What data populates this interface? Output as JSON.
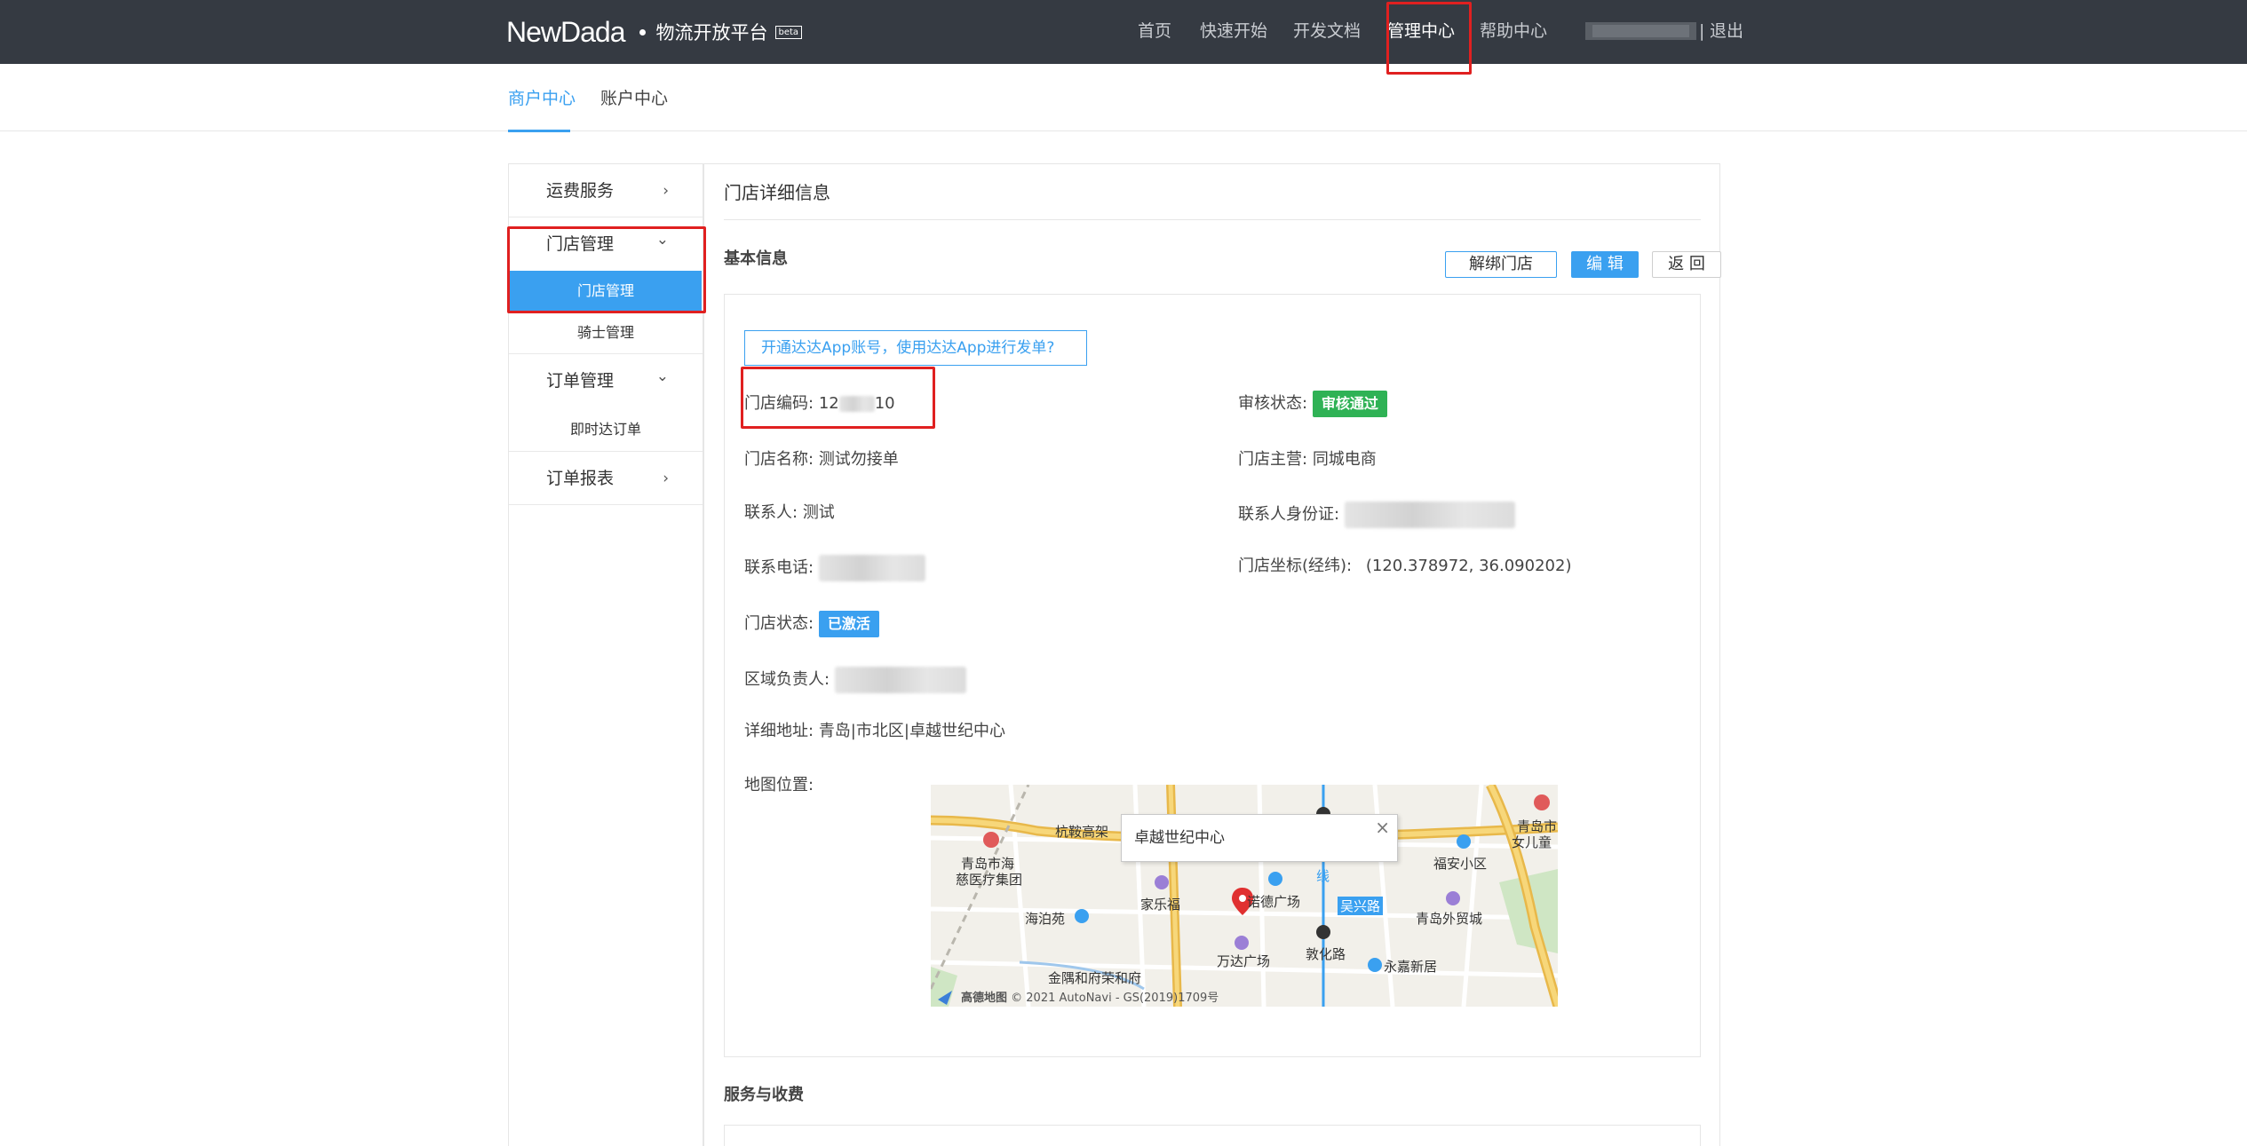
{
  "header": {
    "brand": "NewDada",
    "platform": "物流开放平台",
    "beta": "beta",
    "nav": [
      "首页",
      "快速开始",
      "开发文档",
      "管理中心",
      "帮助中心"
    ],
    "separator": "|",
    "logout": "退出"
  },
  "subnav": {
    "tabs": [
      "商户中心",
      "账户中心"
    ]
  },
  "sidebar": {
    "freight": "运费服务",
    "store_mgmt": "门店管理",
    "store_mgmt_sub": "门店管理",
    "rider_mgmt": "骑士管理",
    "order_mgmt": "订单管理",
    "instant_order": "即时达订单",
    "order_report": "订单报表",
    "chevron_right": "›",
    "chevron_down": "⌄"
  },
  "main": {
    "title": "门店详细信息",
    "basic_info": "基本信息",
    "buttons": {
      "unbind": "解绑门店",
      "edit": "编 辑",
      "back": "返 回"
    },
    "promo": "开通达达App账号，使用达达App进行发单?",
    "fields": {
      "store_code_label": "门店编码:",
      "store_code_prefix": "12",
      "store_code_suffix": "10",
      "review_label": "审核状态:",
      "review_status": "审核通过",
      "store_name_label": "门店名称:",
      "store_name": "测试勿接单",
      "store_category_label": "门店主营:",
      "store_category": "同城电商",
      "contact_label": "联系人:",
      "contact": "测试",
      "contact_id_label": "联系人身份证:",
      "phone_label": "联系电话:",
      "coords_label": "门店坐标(经纬):",
      "coords": "(120.378972, 36.090202)",
      "status_label": "门店状态:",
      "status": "已激活",
      "region_label": "区域负责人:",
      "address_label": "详细地址:",
      "address": "青岛|市北区|卓越世纪中心",
      "map_label": "地图位置:"
    },
    "map": {
      "popup": "卓越世纪中心",
      "close": "×",
      "places": [
        "杭鞍高架",
        "青岛市海",
        "慈医疗集团",
        "家乐福",
        "诺德广场",
        "海泊苑",
        "万达广场",
        "敦化路",
        "永嘉新居",
        "金隅和府荣和府",
        "福安小区",
        "青岛外贸城",
        "青岛市",
        "女儿童",
        "吴兴路",
        "线"
      ],
      "copyright": "© 2021 AutoNavi - GS(2019)1709号",
      "logo": "高德地图"
    },
    "service_fees": "服务与收费"
  },
  "colors": {
    "accent": "#3aa0f0",
    "nav_bg": "#353a42",
    "success": "#2fb255",
    "annotation": "#e02020"
  }
}
